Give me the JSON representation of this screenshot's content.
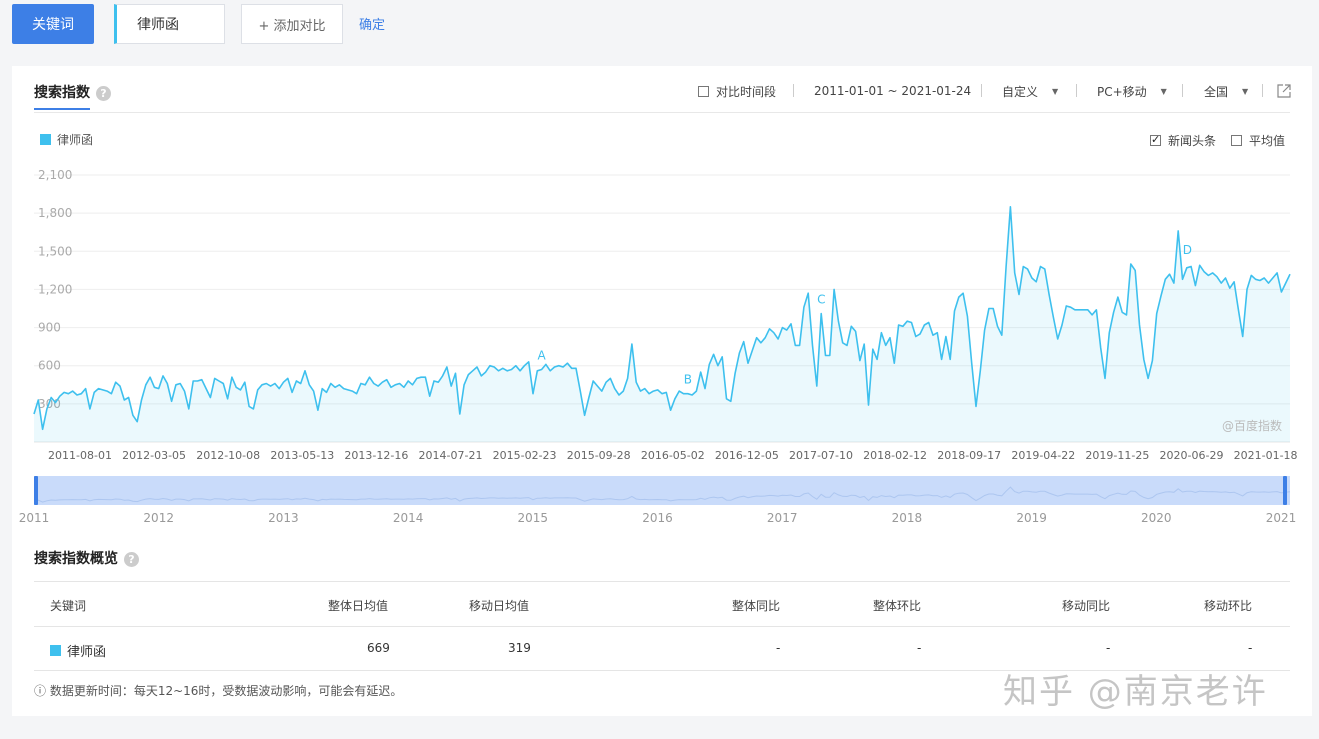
{
  "topbar": {
    "keyword_button": "关键词",
    "keyword_value": "律师函",
    "add_compare": "+ 添加对比",
    "confirm": "确定"
  },
  "panel": {
    "title": "搜索指数",
    "help": "?",
    "compare_period": "对比时间段",
    "date_range": "2011-01-01 ~ 2021-01-24",
    "custom": "自定义",
    "device": "PC+移动",
    "region": "全国"
  },
  "legend": {
    "series_name": "律师函",
    "news_headlines": "新闻头条",
    "average": "平均值"
  },
  "colors": {
    "accent": "#3d7fe6",
    "series": "#3ec0ee"
  },
  "chart_data": {
    "type": "area",
    "series_name": "律师函",
    "y_ticks": [
      "2,100",
      "1,800",
      "1,500",
      "1,200",
      "900",
      "600",
      "300"
    ],
    "ylim": [
      0,
      2100
    ],
    "x_ticks": [
      "2011-08-01",
      "2012-03-05",
      "2012-10-08",
      "2013-05-13",
      "2013-12-16",
      "2014-07-21",
      "2015-02-23",
      "2015-09-28",
      "2016-05-02",
      "2016-12-05",
      "2017-07-10",
      "2018-02-12",
      "2018-09-17",
      "2019-04-22",
      "2019-11-25",
      "2020-06-29",
      "2021-01-18"
    ],
    "x_range": [
      "2011-01-01",
      "2021-01-24"
    ],
    "values": [
      220,
      330,
      100,
      260,
      350,
      310,
      360,
      390,
      380,
      400,
      370,
      380,
      420,
      260,
      390,
      420,
      410,
      400,
      380,
      470,
      440,
      330,
      350,
      210,
      160,
      330,
      450,
      510,
      430,
      420,
      520,
      460,
      320,
      450,
      460,
      400,
      260,
      480,
      480,
      490,
      420,
      350,
      500,
      480,
      460,
      340,
      510,
      430,
      410,
      470,
      280,
      260,
      410,
      450,
      460,
      440,
      460,
      420,
      470,
      500,
      390,
      480,
      460,
      560,
      450,
      400,
      250,
      420,
      390,
      460,
      430,
      450,
      420,
      410,
      400,
      380,
      460,
      450,
      510,
      460,
      440,
      470,
      490,
      430,
      450,
      460,
      430,
      480,
      450,
      500,
      510,
      510,
      360,
      480,
      470,
      520,
      590,
      440,
      540,
      220,
      450,
      530,
      560,
      590,
      520,
      550,
      600,
      590,
      560,
      580,
      560,
      570,
      600,
      560,
      600,
      630,
      380,
      560,
      570,
      610,
      560,
      590,
      600,
      590,
      620,
      580,
      580,
      400,
      210,
      350,
      480,
      440,
      400,
      470,
      500,
      420,
      370,
      400,
      500,
      770,
      470,
      400,
      420,
      380,
      400,
      410,
      380,
      390,
      250,
      340,
      400,
      380,
      380,
      370,
      400,
      550,
      420,
      610,
      690,
      600,
      670,
      340,
      320,
      540,
      700,
      790,
      620,
      720,
      820,
      780,
      820,
      890,
      860,
      810,
      900,
      880,
      930,
      760,
      760,
      1060,
      1170,
      760,
      440,
      1010,
      680,
      680,
      1200,
      950,
      780,
      760,
      910,
      870,
      640,
      770,
      290,
      730,
      650,
      860,
      760,
      820,
      620,
      920,
      910,
      950,
      940,
      830,
      850,
      920,
      940,
      840,
      860,
      650,
      830,
      650,
      1030,
      1140,
      1170,
      990,
      620,
      280,
      560,
      880,
      1050,
      1050,
      910,
      840,
      1380,
      1850,
      1330,
      1160,
      1380,
      1360,
      1290,
      1260,
      1380,
      1360,
      1160,
      980,
      810,
      920,
      1070,
      1060,
      1040,
      1040,
      1040,
      1040,
      1000,
      1040,
      740,
      500,
      860,
      1020,
      1140,
      1020,
      1000,
      1400,
      1350,
      920,
      650,
      500,
      640,
      1010,
      1150,
      1280,
      1320,
      1250,
      1660,
      1280,
      1370,
      1380,
      1230,
      1390,
      1340,
      1310,
      1330,
      1300,
      1250,
      1290,
      1210,
      1260,
      1040,
      830,
      1200,
      1310,
      1280,
      1270,
      1290,
      1250,
      1290,
      1330,
      1180,
      1250,
      1320
    ],
    "annotations": [
      "A",
      "B",
      "C",
      "D"
    ],
    "watermark": "@百度指数",
    "years": [
      "2011",
      "2012",
      "2013",
      "2014",
      "2015",
      "2016",
      "2017",
      "2018",
      "2019",
      "2020",
      "2021"
    ]
  },
  "summary": {
    "title": "搜索指数概览",
    "headers": {
      "keyword": "关键词",
      "overall_daily": "整体日均值",
      "mobile_daily": "移动日均值",
      "overall_yoy": "整体同比",
      "overall_mom": "整体环比",
      "mobile_yoy": "移动同比",
      "mobile_mom": "移动环比"
    },
    "row": {
      "keyword": "律师函",
      "overall_daily": "669",
      "mobile_daily": "319",
      "overall_yoy": "-",
      "overall_mom": "-",
      "mobile_yoy": "-",
      "mobile_mom": "-"
    },
    "footnote": "ⓘ 数据更新时间：每天12~16时，受数据波动影响，可能会有延迟。"
  },
  "watermark_text": "知乎 @南京老许"
}
